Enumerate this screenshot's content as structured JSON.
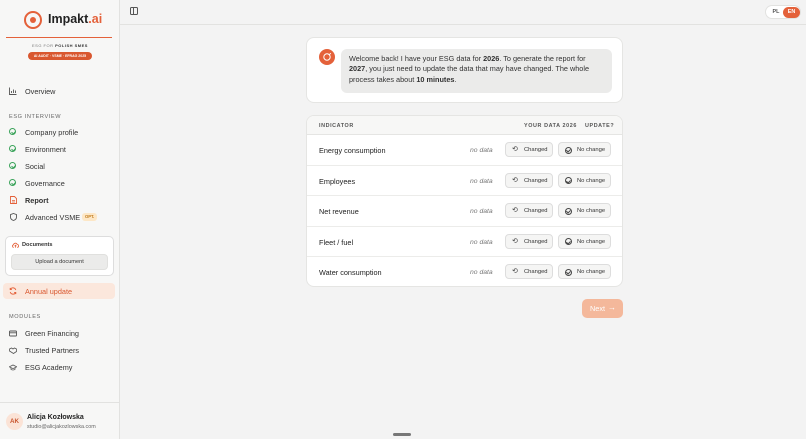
{
  "brand": {
    "name": "Impakt",
    "suffix": ".ai",
    "tagline_prefix": "ESG FOR",
    "tagline_bold": "POLISH SMES",
    "pill": "AI AUDIT · VSME · EFRAG 2025",
    "accent": "#e4613a"
  },
  "sidebar": {
    "overview": {
      "label": "Overview",
      "icon": "bar-chart-icon"
    },
    "esg_section": "ESG INTERVIEW",
    "esg_items": [
      {
        "label": "Company profile",
        "icon": "check-circle-icon",
        "done": true
      },
      {
        "label": "Environment",
        "icon": "check-circle-icon",
        "done": true
      },
      {
        "label": "Social",
        "icon": "check-circle-icon",
        "done": true
      },
      {
        "label": "Governance",
        "icon": "check-circle-icon",
        "done": true
      }
    ],
    "report": {
      "label": "Report",
      "icon": "document-icon"
    },
    "advanced": {
      "label": "Advanced VSME",
      "badge": "OPT.",
      "icon": "shield-icon"
    },
    "documents": {
      "title": "Documents",
      "upload_label": "Upload a document",
      "icon": "cloud-upload-icon"
    },
    "annual_update": {
      "label": "Annual update",
      "icon": "refresh-icon"
    },
    "modules_section": "MODULES",
    "modules": [
      {
        "label": "Green Financing",
        "icon": "card-icon"
      },
      {
        "label": "Trusted Partners",
        "icon": "handshake-icon"
      },
      {
        "label": "ESG Academy",
        "icon": "graduation-cap-icon"
      }
    ]
  },
  "user": {
    "initials": "AK",
    "name": "Alicja Kozłowska",
    "email": "studio@alicjakozlowska.com"
  },
  "topbar": {
    "lang_options": [
      "PL",
      "EN"
    ],
    "lang_selected": "EN"
  },
  "chat": {
    "t1": "Welcome back! I have your ESG data for ",
    "year_data": "2026",
    "t2": ". To generate the report for ",
    "year_report": "2027",
    "t3": ", you just need to update the data that may have changed. The whole process takes about ",
    "duration": "10 minutes",
    "t4": "."
  },
  "table": {
    "headers": {
      "indicator": "INDICATOR",
      "your_data": "YOUR DATA 2026",
      "update": "UPDATE?"
    },
    "changed_label": "Changed",
    "nochange_label": "No change",
    "rows": [
      {
        "indicator": "Energy consumption",
        "value": "no data"
      },
      {
        "indicator": "Employees",
        "value": "no data"
      },
      {
        "indicator": "Net revenue",
        "value": "no data"
      },
      {
        "indicator": "Fleet / fuel",
        "value": "no data"
      },
      {
        "indicator": "Water consumption",
        "value": "no data"
      }
    ]
  },
  "next_label": "Next"
}
